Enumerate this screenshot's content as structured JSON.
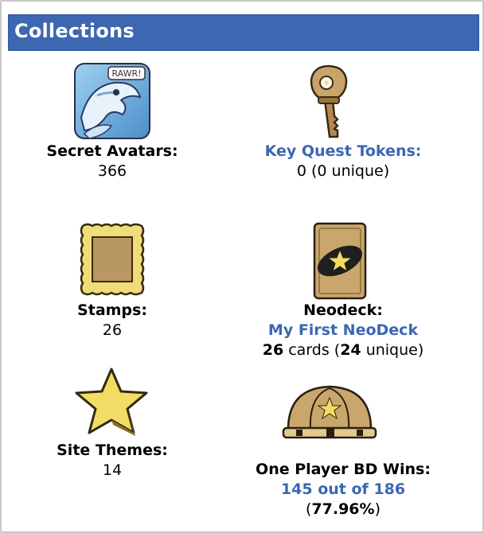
{
  "panel": {
    "title": "Collections"
  },
  "items": {
    "avatars": {
      "label": "Secret Avatars:",
      "value": "366",
      "badge": "RAWR!"
    },
    "keyquest": {
      "label": "Key Quest Tokens:",
      "value": "0 (0 unique)"
    },
    "stamps": {
      "label": "Stamps:",
      "value": "26"
    },
    "neodeck": {
      "label": "Neodeck:",
      "link": "My First NeoDeck",
      "cards": "26",
      "cards_word": " cards (",
      "unique": "24",
      "unique_word": " unique)"
    },
    "themes": {
      "label": "Site Themes:",
      "value": "14"
    },
    "battledome": {
      "label": "One Player BD Wins:",
      "link": "145 out of 186",
      "open": "(",
      "percent": "77.96%",
      "close": ")"
    }
  },
  "icons": [
    "avatar-icon",
    "key-icon",
    "stamp-icon",
    "neodeck-card-icon",
    "star-icon",
    "battledome-icon"
  ],
  "colors": {
    "header": "#3d67b0",
    "link": "#3b67b2",
    "gold": "#c8a86a",
    "star": "#f2dc64"
  }
}
